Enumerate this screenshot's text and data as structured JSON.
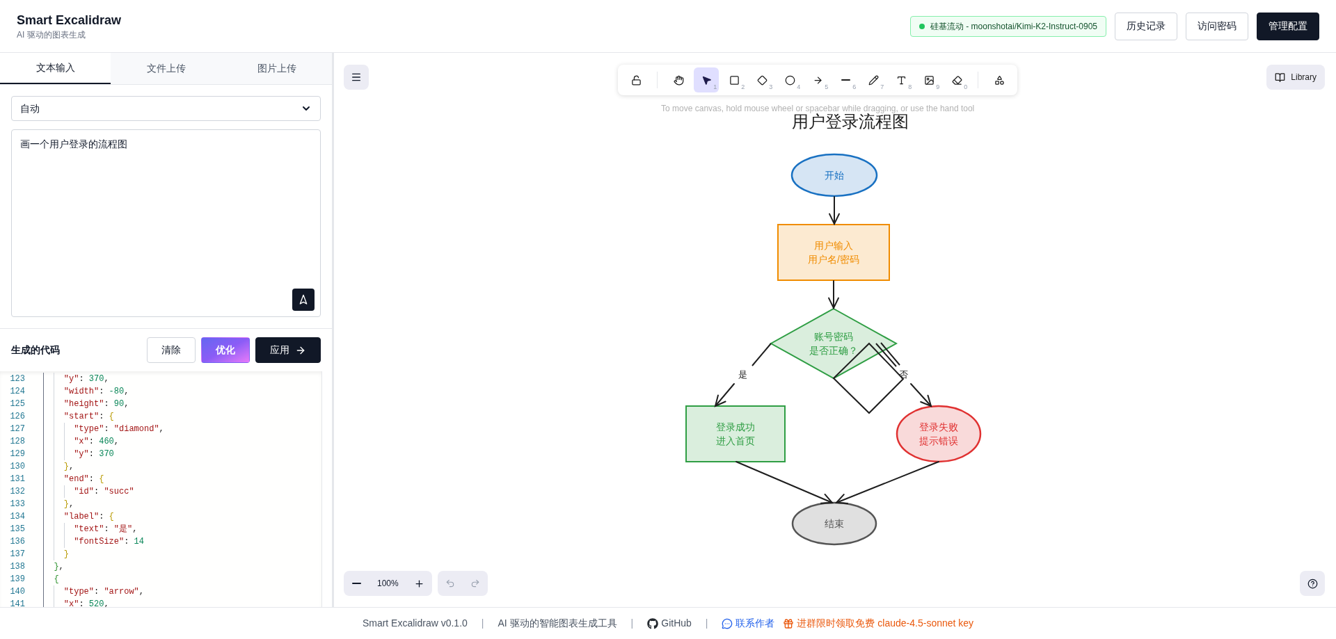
{
  "header": {
    "title": "Smart Excalidraw",
    "subtitle": "AI 驱动的图表生成",
    "model": {
      "label": "硅基流动 - moonshotai/Kimi-K2-Instruct-0905",
      "color": "#22c55e"
    },
    "buttons": [
      {
        "label": "历史记录",
        "kind": "outline"
      },
      {
        "label": "访问密码",
        "kind": "outline"
      },
      {
        "label": "管理配置",
        "kind": "solid"
      }
    ]
  },
  "left_panel": {
    "tabs": [
      {
        "label": "文本输入",
        "selected": true
      },
      {
        "label": "文件上传",
        "selected": false
      },
      {
        "label": "图片上传",
        "selected": false
      }
    ],
    "mode_select": {
      "value": "自动"
    },
    "prompt": {
      "value": "画一个用户登录的流程图"
    },
    "code_section": {
      "title": "生成的代码",
      "buttons": [
        {
          "label": "清除",
          "kind": "outline"
        },
        {
          "label": "优化",
          "kind": "gradient"
        },
        {
          "label": "应用",
          "kind": "solid"
        }
      ]
    },
    "code_lines": [
      {
        "number": "123",
        "text": "    \"y\": 370,"
      },
      {
        "number": "124",
        "text": "    \"width\": -80,"
      },
      {
        "number": "125",
        "text": "    \"height\": 90,"
      },
      {
        "number": "126",
        "text": "    \"start\": {"
      },
      {
        "number": "127",
        "text": "      \"type\": \"diamond\","
      },
      {
        "number": "128",
        "text": "      \"x\": 460,"
      },
      {
        "number": "129",
        "text": "      \"y\": 370"
      },
      {
        "number": "130",
        "text": "    },"
      },
      {
        "number": "131",
        "text": "    \"end\": {"
      },
      {
        "number": "132",
        "text": "      \"id\": \"succ\""
      },
      {
        "number": "133",
        "text": "    },"
      },
      {
        "number": "134",
        "text": "    \"label\": {"
      },
      {
        "number": "135",
        "text": "      \"text\": \"是\","
      },
      {
        "number": "136",
        "text": "      \"fontSize\": 14"
      },
      {
        "number": "137",
        "text": "    }"
      },
      {
        "number": "138",
        "text": "  },"
      },
      {
        "number": "139",
        "text": "  {"
      },
      {
        "number": "140",
        "text": "    \"type\": \"arrow\","
      },
      {
        "number": "141",
        "text": "    \"x\": 520,"
      }
    ]
  },
  "canvas": {
    "tools": [
      {
        "kind": "lock",
        "selected": false
      },
      {
        "kind": "hand",
        "selected": false
      },
      {
        "kind": "selection",
        "shortcut": "1",
        "selected": true
      },
      {
        "kind": "rectangle",
        "shortcut": "2",
        "selected": false
      },
      {
        "kind": "diamond",
        "shortcut": "3",
        "selected": false
      },
      {
        "kind": "ellipse",
        "shortcut": "4",
        "selected": false
      },
      {
        "kind": "arrow",
        "shortcut": "5",
        "selected": false
      },
      {
        "kind": "line",
        "shortcut": "6",
        "selected": false
      },
      {
        "kind": "draw",
        "shortcut": "7",
        "selected": false
      },
      {
        "kind": "text",
        "shortcut": "8",
        "selected": false
      },
      {
        "kind": "image",
        "shortcut": "9",
        "selected": false
      },
      {
        "kind": "eraser",
        "shortcut": "0",
        "selected": false
      },
      {
        "kind": "extra",
        "selected": false
      }
    ],
    "library_label": "Library",
    "hint": "To move canvas, hold mouse wheel or spacebar while dragging, or use the hand tool",
    "zoom": "100%",
    "diagram": {
      "title": "用户登录流程图",
      "nodes": [
        {
          "kind": "ellipse",
          "lines": [
            "开始"
          ],
          "color": "#1971c2"
        },
        {
          "kind": "rectangle",
          "lines": [
            "用户输入",
            "用户名/密码"
          ],
          "color": "#f08c00"
        },
        {
          "kind": "diamond",
          "lines": [
            "账号密码",
            "是否正确？"
          ],
          "color": "#2f9e44"
        },
        {
          "kind": "rectangle",
          "lines": [
            "登录成功",
            "进入首页"
          ],
          "color": "#2f9e44"
        },
        {
          "kind": "ellipse",
          "lines": [
            "登录失败",
            "提示错误"
          ],
          "color": "#e03131"
        },
        {
          "kind": "ellipse",
          "lines": [
            "结束"
          ],
          "color": "#555555"
        }
      ],
      "edge_labels": [
        "是",
        "否"
      ]
    }
  },
  "footer": [
    {
      "kind": "text",
      "text": "Smart Excalidraw v0.1.0"
    },
    {
      "kind": "separator",
      "text": "|"
    },
    {
      "kind": "text",
      "text": "AI 驱动的智能图表生成工具"
    },
    {
      "kind": "separator",
      "text": "|"
    },
    {
      "kind": "github",
      "text": "GitHub"
    },
    {
      "kind": "separator",
      "text": "|"
    },
    {
      "kind": "contact",
      "text": "联系作者"
    },
    {
      "kind": "promo",
      "text": "进群限时领取免费 claude-4.5-sonnet key"
    }
  ]
}
